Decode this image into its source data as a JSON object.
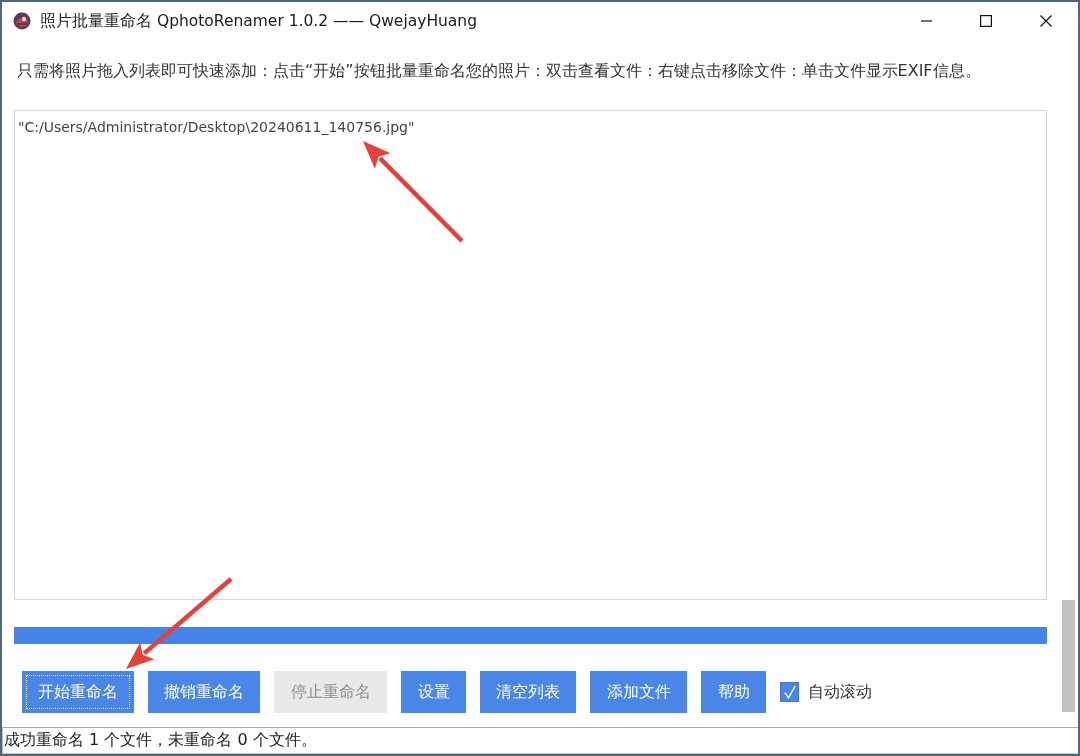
{
  "window": {
    "title": "照片批量重命名 QphotoRenamer 1.0.2 —— QwejayHuang"
  },
  "hint": "只需将照片拖入列表即可快速添加：点击“开始”按钮批量重命名您的照片：双击查看文件：右键点击移除文件：单击文件显示EXIF信息。",
  "file_list": {
    "items": [
      {
        "path": "\"C:/Users/Administrator/Desktop\\20240611_140756.jpg\"",
        "selected": false
      }
    ]
  },
  "progress": {
    "level": 1
  },
  "buttons": [
    {
      "label": "开始重命名",
      "focused": true,
      "disabled": false
    },
    {
      "label": "撤销重命名",
      "focused": false,
      "disabled": false
    },
    {
      "label": "停止重命名",
      "focused": false,
      "disabled": true
    },
    {
      "label": "设置",
      "focused": false,
      "disabled": false
    },
    {
      "label": "清空列表",
      "focused": false,
      "disabled": false
    },
    {
      "label": "添加文件",
      "focused": false,
      "disabled": false
    },
    {
      "label": "帮助",
      "focused": false,
      "disabled": false
    }
  ],
  "auto_scroll": {
    "label": "自动滚动",
    "checked": true
  },
  "status_bar": {
    "text": "成功重命名 1 个文件，未重命名 0 个文件。"
  },
  "annotations": [
    {
      "kind": "arrow"
    },
    {
      "kind": "arrow"
    }
  ]
}
